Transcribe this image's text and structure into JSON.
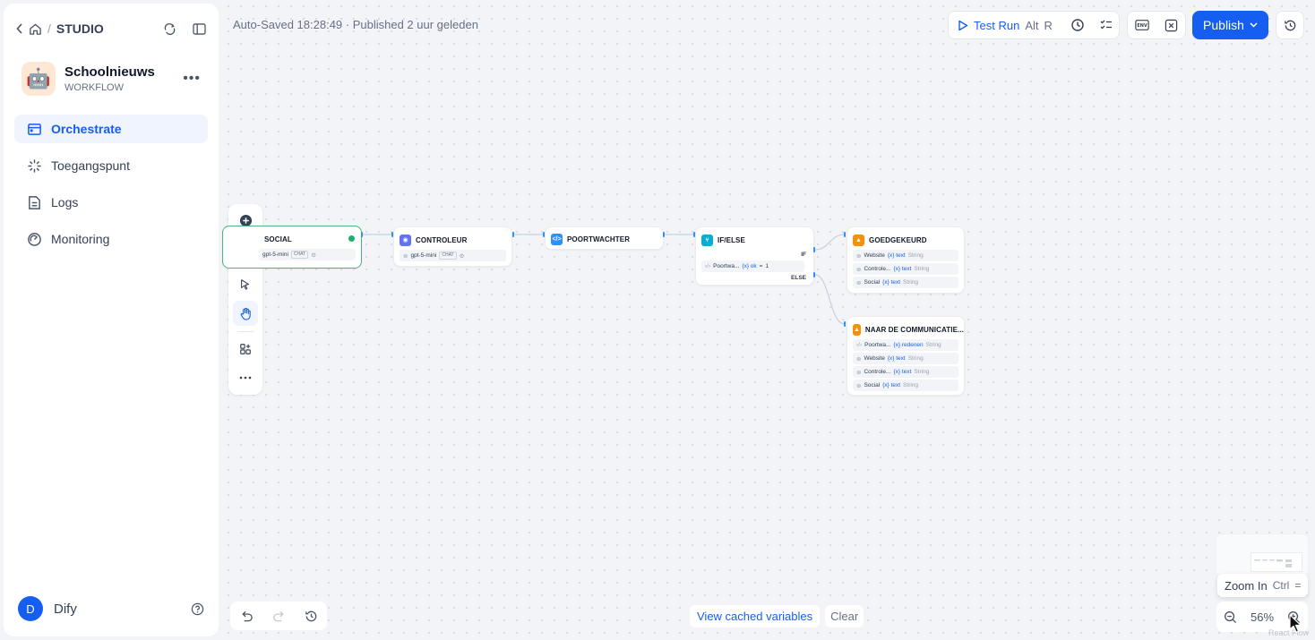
{
  "sidebar": {
    "breadcrumb": {
      "section": "STUDIO",
      "separator": "/"
    },
    "app": {
      "name": "Schoolnieuws",
      "type": "WORKFLOW",
      "icon": "robot-emoji",
      "emoji": "🤖"
    },
    "nav": [
      {
        "label": "Orchestrate",
        "icon": "orchestrate-icon",
        "active": true
      },
      {
        "label": "Toegangspunt",
        "icon": "access-point-icon",
        "active": false
      },
      {
        "label": "Logs",
        "icon": "logs-icon",
        "active": false
      },
      {
        "label": "Monitoring",
        "icon": "monitoring-icon",
        "active": false
      }
    ],
    "user": {
      "initial": "D",
      "name": "Dify"
    }
  },
  "header": {
    "autosave": "Auto-Saved 18:28:49 · Published 2 uur geleden",
    "test_run": {
      "label": "Test Run",
      "kbd1": "Alt",
      "kbd2": "R"
    },
    "env_label": "ENV",
    "publish_label": "Publish"
  },
  "nodes": {
    "social": {
      "title": "SOCIAL",
      "model": "gpt-5-mini",
      "chip": "CHAT"
    },
    "controleur": {
      "title": "CONTROLEUR",
      "model": "gpt-5-mini",
      "chip": "CHAT"
    },
    "poortwachter": {
      "title": "POORTWACHTER"
    },
    "ifelse": {
      "title": "IF/ELSE",
      "cond_var": "Poortwa...",
      "cond_field": "{x} ok",
      "cond_op": "=",
      "cond_val": "1",
      "if_label": "IF",
      "else_label": "ELSE"
    },
    "goedgekeurd": {
      "title": "GOEDGEKEURD",
      "rows": [
        {
          "node": "Website",
          "var": "{x} text",
          "type": "String"
        },
        {
          "node": "Controle...",
          "var": "{x} text",
          "type": "String"
        },
        {
          "node": "Social",
          "var": "{x} text",
          "type": "String"
        }
      ]
    },
    "communicatie": {
      "title": "NAAR DE COMMUNICATIE...",
      "rows": [
        {
          "node": "Poortwa...",
          "var": "{x} redenen",
          "type": "String"
        },
        {
          "node": "Website",
          "var": "{x} text",
          "type": "String"
        },
        {
          "node": "Controle...",
          "var": "{x} text",
          "type": "String"
        },
        {
          "node": "Social",
          "var": "{x} text",
          "type": "String"
        }
      ]
    }
  },
  "footer": {
    "view_cached": "View cached variables",
    "clear": "Clear",
    "zoom_level": "56%",
    "tooltip": {
      "label": "Zoom In",
      "kbd1": "Ctrl",
      "kbd2": "="
    },
    "watermark": "React Flow"
  },
  "colors": {
    "accent": "#155eef",
    "llm_node": "#6172f3",
    "code_node": "#2e90fa",
    "ifelse_node": "#06aed4",
    "end_node": "#f79009",
    "success": "#17b26a"
  }
}
